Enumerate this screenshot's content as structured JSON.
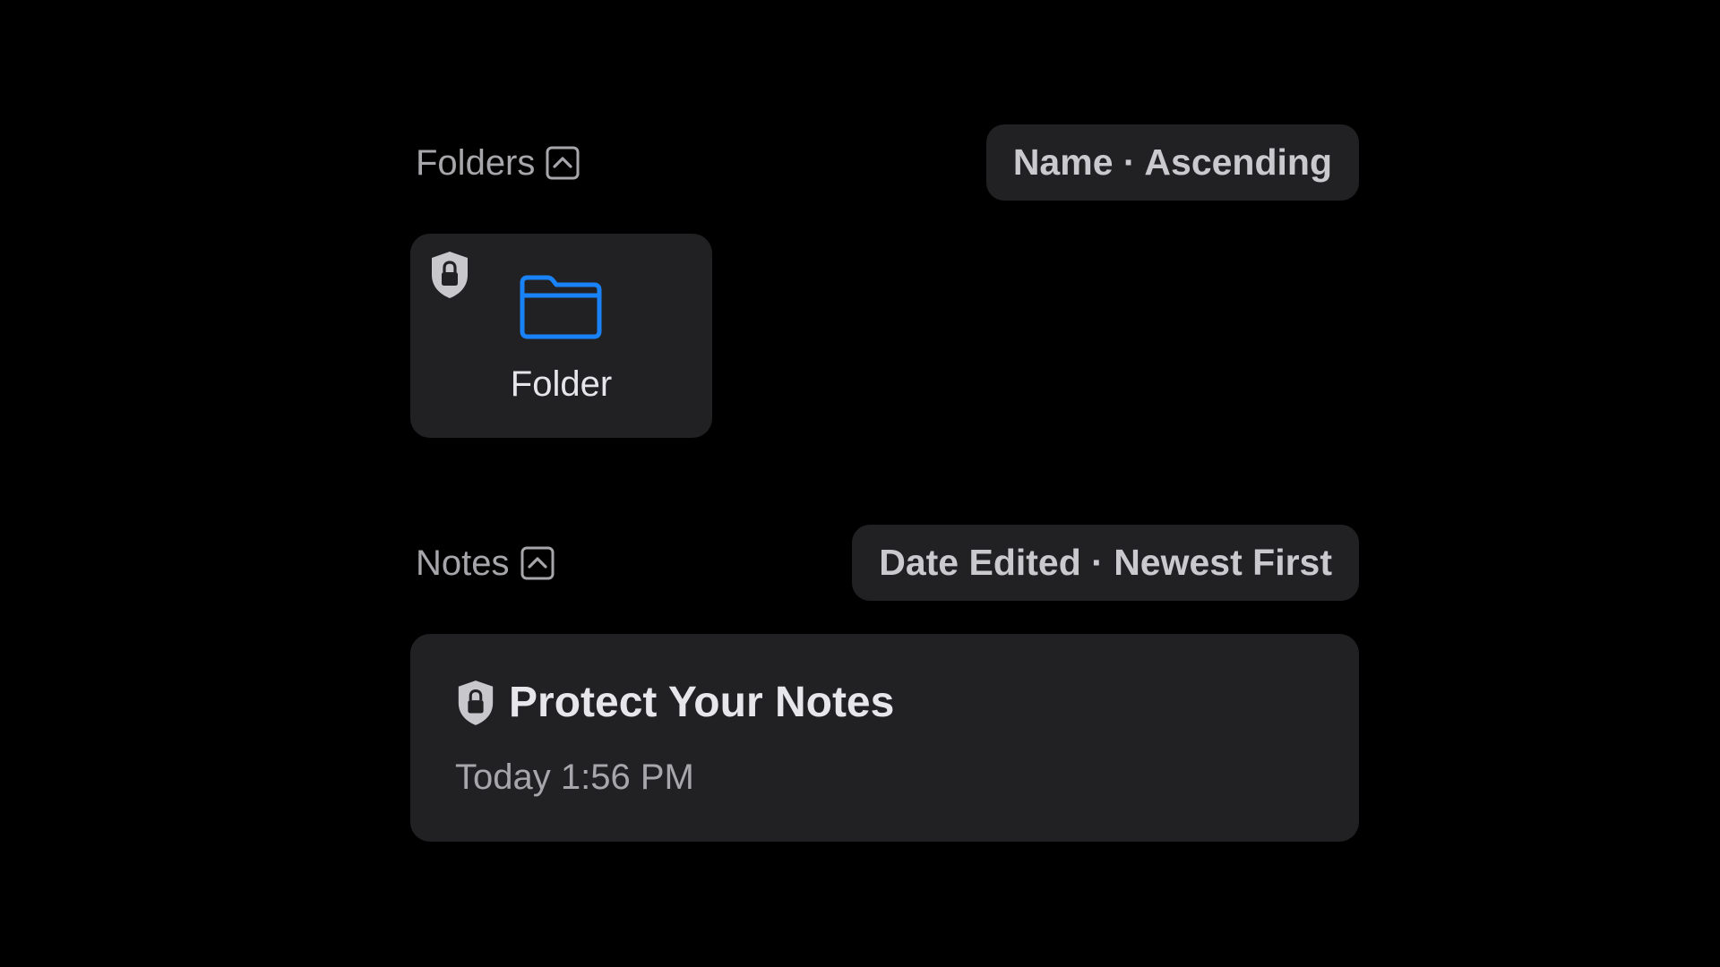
{
  "colors": {
    "background": "#000000",
    "card": "#212123",
    "accent_blue": "#1a82f7",
    "label_gray": "#a6a6ab",
    "text_light": "#e6e6eb",
    "lock_gray": "#c7c7cc"
  },
  "folders_section": {
    "title": "Folders",
    "collapse_icon": "chevron-up-square-icon",
    "sort_label": "Name · Ascending",
    "items": [
      {
        "label": "Folder",
        "icon": "folder-icon",
        "badge_icon": "lock-shield-icon"
      }
    ]
  },
  "notes_section": {
    "title": "Notes",
    "collapse_icon": "chevron-up-square-icon",
    "sort_label": "Date Edited · Newest First",
    "items": [
      {
        "title": "Protect Your Notes",
        "date": "Today 1:56 PM",
        "badge_icon": "lock-shield-icon"
      }
    ]
  }
}
